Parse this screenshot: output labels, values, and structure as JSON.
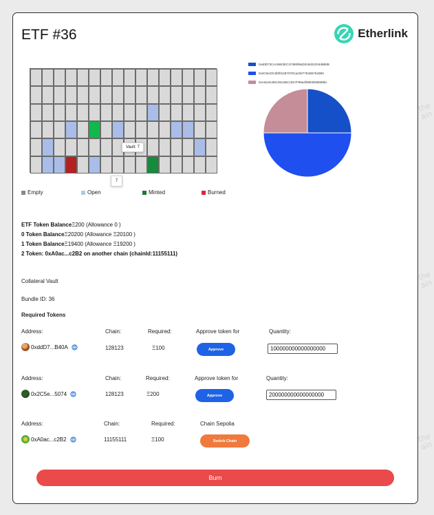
{
  "header": {
    "title": "ETF #36",
    "brand": "Etherlink"
  },
  "grid": {
    "rows": 6,
    "cols": 16,
    "cells": [
      "",
      "",
      "",
      "",
      "",
      "",
      "",
      "",
      "",
      "",
      "",
      "",
      "",
      "",
      "",
      "",
      "",
      "",
      "",
      "",
      "",
      "",
      "",
      "",
      "",
      "",
      "",
      "",
      "",
      "",
      "",
      "",
      "",
      "",
      "",
      "",
      "",
      "",
      "",
      "",
      "",
      "",
      "open",
      "",
      "",
      "",
      "",
      "",
      "",
      "",
      "",
      "open",
      "",
      "minted",
      "",
      "open",
      "",
      "",
      "",
      "",
      "open",
      "open",
      "",
      "",
      "",
      "open",
      "",
      "",
      "",
      "",
      "",
      "",
      "",
      "",
      "",
      "",
      "",
      "",
      "open",
      "",
      "",
      "open",
      "open",
      "burned",
      "",
      "open",
      "",
      "",
      "",
      "",
      "minted2",
      "",
      "",
      "",
      "",
      ""
    ],
    "tooltip": "Vault: 7",
    "tooltip_arrow": "7"
  },
  "legend": {
    "empty": "Empty",
    "open": "Open",
    "minted": "Minted",
    "burned": "Burned"
  },
  "colors": {
    "empty": "#d9d9d9",
    "open": "#a9bde8",
    "minted": "#1a7a33",
    "burned": "#d9263a",
    "pie1": "#1650c8",
    "pie2": "#1f4fef",
    "pie3": "#c48d98"
  },
  "pie": {
    "legend": [
      "0xddD73CAc56E3EC1F38089aD019d41034d6B0B",
      "0x2C5e23Cdbf021B707D1a4257754B6761B50",
      "0xA0ac5c96C3612BC1De7F89a4f0894D88588bc"
    ]
  },
  "chart_data": {
    "type": "pie",
    "slices": [
      {
        "label": "0xddD73CAc56E3EC1F38089aD019d41034d6B0B",
        "value": 25,
        "color": "#1650c8"
      },
      {
        "label": "0x2C5e23Cdbf021B707D1a4257754B6761B50",
        "value": 50,
        "color": "#1f4fef"
      },
      {
        "label": "0xA0ac5c96C3612BC1De7F89a4f0894D88588bc",
        "value": 25,
        "color": "#c48d98"
      }
    ]
  },
  "balances": {
    "etf_label": "ETF Token Balance",
    "etf_value": "Ξ200 (Allowance 0 )",
    "t0_label": "0 Token Balance",
    "t0_value": "Ξ20200 (Allowance Ξ20100 )",
    "t1_label": "1 Token Balance",
    "t1_value": "Ξ19400 (Allowance Ξ19200 )",
    "t2_text": "2 Token: 0xA0ac...c2B2 on another chain (chainId:11155111)"
  },
  "vault": {
    "collateral": "Collateral Vault",
    "bundle": "Bundle ID: 36",
    "required": "Required Tokens"
  },
  "tokens": [
    {
      "address_label": "Address:",
      "chain_label": "Chain:",
      "required_label": "Required:",
      "action_label": "Approve token for",
      "qty_label": "Quantity:",
      "address": "0xddD7...B40A",
      "chain": "128123",
      "required": "Ξ100",
      "button": "Approve",
      "quantity": "100000000000000000"
    },
    {
      "address_label": "Address:",
      "chain_label": "Chain:",
      "required_label": "Required:",
      "action_label": "Approve token for",
      "qty_label": "Quantity:",
      "address": "0x2C5e...5074",
      "chain": "128123",
      "required": "Ξ200",
      "button": "Approve",
      "quantity": "200000000000000000"
    },
    {
      "address_label": "Address:",
      "chain_label": "Chain:",
      "required_label": "Required:",
      "action_label": "Chain Sepolia",
      "address": "0xA0ac...c2B2",
      "chain": "11155111",
      "required": "Ξ100",
      "button": "Switch Chain"
    }
  ],
  "footer": {
    "burn": "Burn"
  },
  "watermark": "the\nain"
}
